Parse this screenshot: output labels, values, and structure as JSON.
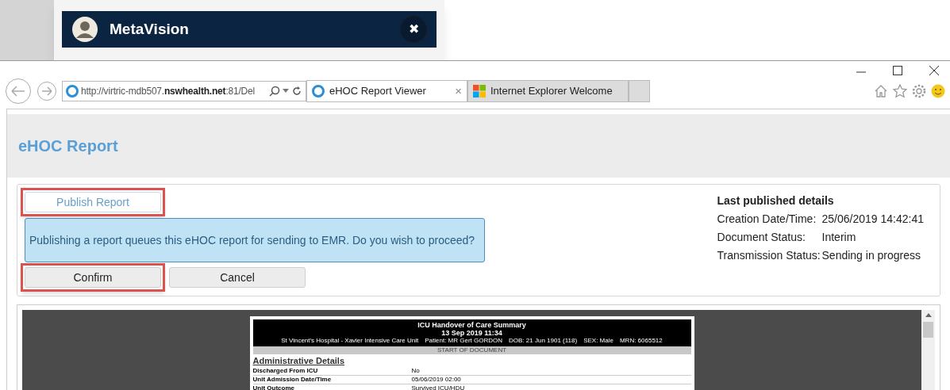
{
  "background_window": {
    "title": "MetaVision",
    "close_glyph": "✖"
  },
  "browser": {
    "address": {
      "prefix": "http://virtric-mdb507.",
      "domain": "nswhealth.net",
      "suffix": ":81/Del"
    },
    "tabs": [
      {
        "label": "eHOC Report Viewer",
        "selected": true,
        "close": "×"
      },
      {
        "label": "Internet Explorer Welcome",
        "selected": false
      }
    ]
  },
  "page": {
    "title": "eHOC Report",
    "publish_button": {
      "label": "Publish Report",
      "highlighted": true
    },
    "message": "Publishing a report queues this eHOC report for sending to EMR. Do you wish to proceed?",
    "actions": [
      {
        "label": "Confirm",
        "highlighted": true
      },
      {
        "label": "Cancel",
        "highlighted": false
      }
    ],
    "last_published": {
      "heading": "Last published details",
      "rows": [
        {
          "label": "Creation Date/Time:",
          "value": "25/06/2019 14:42:41"
        },
        {
          "label": "Document Status:",
          "value": "Interim"
        },
        {
          "label": "Transmission Status:",
          "value": "Sending in progress"
        }
      ]
    }
  },
  "document": {
    "title": "ICU Handover of Care Summary",
    "date": "13 Sep 2019 11:34",
    "info": [
      "St Vincent's Hospital - Xavier Intensive Care Unit",
      "Patient: MR Gert GORDON",
      "DOB: 21 Jun 1901 (118)",
      "SEX: Male",
      "MRN: 6065512"
    ],
    "banner": "START OF DOCUMENT",
    "section": "Administrative Details",
    "rows": [
      {
        "label": "Discharged From ICU",
        "value": "No"
      },
      {
        "label": "Unit Admission Date/Time",
        "value": "05/06/2019 02:00"
      },
      {
        "label": "Unit Outcome",
        "value": "Survived ICU/HDU"
      }
    ]
  }
}
